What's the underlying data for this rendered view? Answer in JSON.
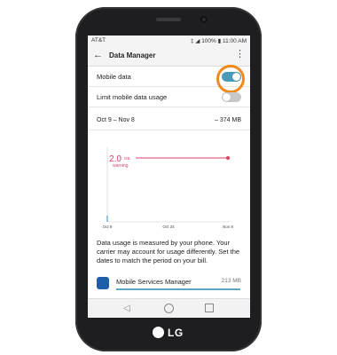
{
  "status_bar": {
    "carrier": "AT&T",
    "right_text": "‡ ◢ 100% ▮ 11:00 AM"
  },
  "toolbar": {
    "title": "Data Manager",
    "back_icon": "back-arrow-icon",
    "menu_icon": "overflow-menu-icon"
  },
  "settings": {
    "mobile_data": {
      "label": "Mobile data",
      "enabled": true
    },
    "limit_usage": {
      "label": "Limit mobile data usage",
      "enabled": false
    }
  },
  "period": {
    "range": "Oct 9 – Nov 8",
    "usage": "374 MB",
    "separator": "–"
  },
  "chart_data": {
    "type": "line",
    "warning": {
      "value": "2.0",
      "unit": "GB",
      "label": "warning"
    },
    "x_ticks": [
      "Oct 9",
      "Oct 24",
      "Nov 8"
    ],
    "color_warning": "#d9416a",
    "color_usage": "#6aa9cf"
  },
  "description": "Data usage is measured by your phone. Your carrier may account for usage differently. Set the dates to match the period on your bill.",
  "apps": [
    {
      "name": "Mobile Services Manager",
      "size": "213 MB"
    }
  ],
  "branding": {
    "logo_text": "LG"
  },
  "colors": {
    "accent": "#4a9bb9",
    "highlight": "#f08a1c"
  }
}
